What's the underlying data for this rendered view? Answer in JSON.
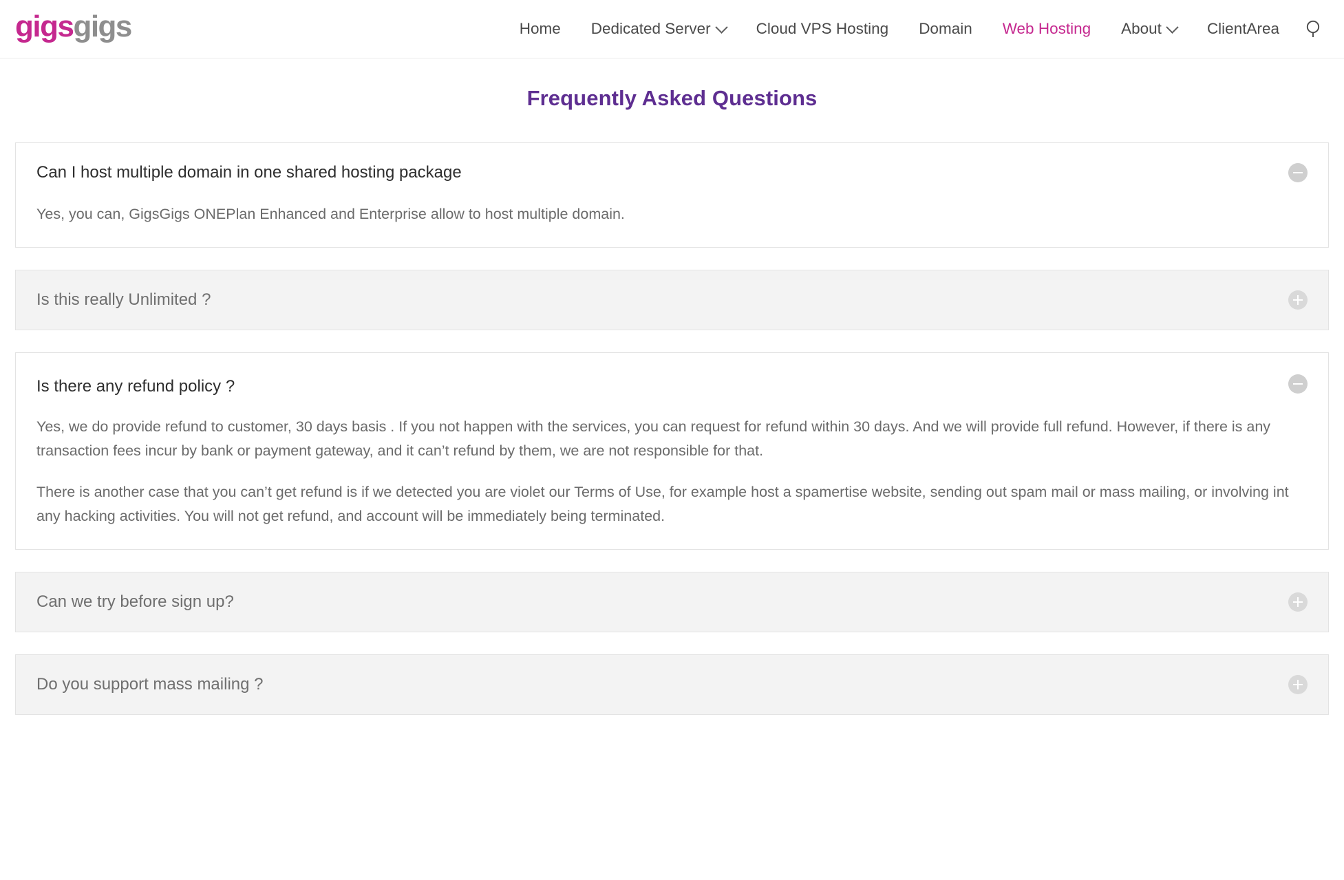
{
  "header": {
    "logo": {
      "part1": "gigs",
      "part2": "gigs"
    },
    "nav": [
      {
        "label": "Home",
        "icon": null,
        "active": false
      },
      {
        "label": "Dedicated Server",
        "icon": "chevron-down-icon",
        "active": false
      },
      {
        "label": "Cloud VPS Hosting",
        "icon": null,
        "active": false
      },
      {
        "label": "Domain",
        "icon": null,
        "active": false
      },
      {
        "label": "Web Hosting",
        "icon": null,
        "active": true
      },
      {
        "label": "About",
        "icon": "chevron-down-icon",
        "active": false
      },
      {
        "label": "ClientArea",
        "icon": null,
        "active": false
      }
    ],
    "search_icon": "search-icon"
  },
  "page": {
    "title": "Frequently Asked Questions",
    "title_color": "#5e2e91",
    "accent_color": "#c5288f"
  },
  "faq": [
    {
      "question": "Can I host multiple domain in one shared hosting package",
      "state": "open",
      "toggle_icon": "minus-circle-icon",
      "answers": [
        "Yes, you can, GigsGigs ONEPlan Enhanced and Enterprise allow to host multiple domain."
      ]
    },
    {
      "question": "Is this really Unlimited ?",
      "state": "closed",
      "toggle_icon": "plus-circle-icon",
      "answers": []
    },
    {
      "question": "Is there any refund policy ?",
      "state": "open",
      "toggle_icon": "minus-circle-icon",
      "answers": [
        "Yes, we do provide refund to customer, 30 days basis . If you not happen with the services, you can request for refund within 30 days. And we will provide full refund.  However, if there is any transaction fees incur by bank or payment gateway, and it can’t refund by them, we are not responsible for that.",
        "There is another case that you can’t get refund is if we detected you are violet our Terms of Use, for example host a spamertise website, sending out spam mail or mass mailing, or involving int any hacking activities. You will not get refund, and account will be immediately being terminated."
      ]
    },
    {
      "question": "Can we try before sign up?",
      "state": "closed",
      "toggle_icon": "plus-circle-icon",
      "answers": []
    },
    {
      "question": "Do you support mass mailing ?",
      "state": "closed",
      "toggle_icon": "plus-circle-icon",
      "answers": []
    }
  ]
}
